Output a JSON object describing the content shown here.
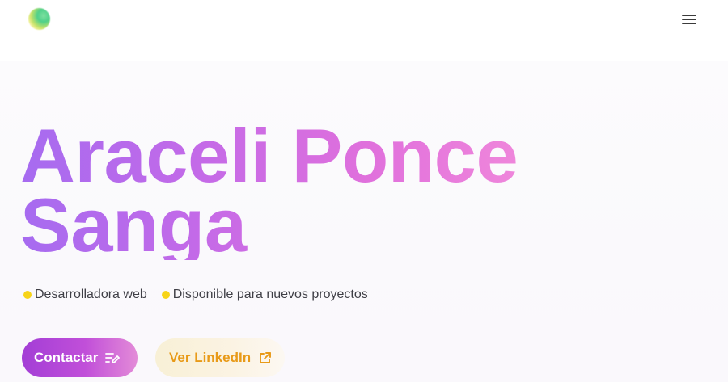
{
  "header": {
    "logo_icon": "gradient-orb-logo",
    "menu_icon": "hamburger-menu-icon"
  },
  "hero": {
    "name_line1": "Araceli Ponce",
    "name_line2": "Sanga",
    "tags": [
      {
        "label": "Desarrolladora web",
        "dot_color": "#f7d418"
      },
      {
        "label": "Disponible para nuevos proyectos",
        "dot_color": "#f7d418"
      }
    ],
    "buttons": {
      "contact_label": "Contactar",
      "contact_icon": "list-pen-icon",
      "linkedin_label": "Ver LinkedIn",
      "linkedin_icon": "external-link-icon"
    }
  },
  "colors": {
    "title_gradient_start": "#a66bf0",
    "title_gradient_end": "#ef86db",
    "accent_purple": "#a33ed6",
    "accent_orange": "#e89a18",
    "tag_dot": "#f7d418"
  }
}
